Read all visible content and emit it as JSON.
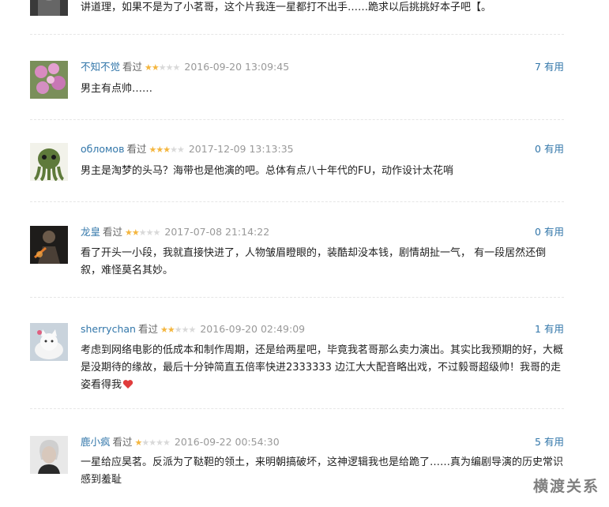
{
  "colors": {
    "link": "#3377aa",
    "star_on": "#f4b63f",
    "star_off": "#d9d9d9",
    "date": "#999999",
    "heart": "#e03c3c"
  },
  "top_partial": {
    "text": "讲道理，如果不是为了小茗哥，这个片我连一星都打不出手……跪求以后挑挑好本子吧【。",
    "avatar_icon": "avatar-dark-icon"
  },
  "reviews": [
    {
      "user": "不知不觉",
      "status": "看过",
      "rating": 2,
      "date": "2016-09-20 13:09:45",
      "votes": "7",
      "votes_suffix": "有用",
      "text": "男主有点帅……",
      "avatar_icon": "avatar-flowers-icon"
    },
    {
      "user": "обломов",
      "status": "看过",
      "rating": 3,
      "date": "2017-12-09 13:13:35",
      "votes": "0",
      "votes_suffix": "有用",
      "text": "男主是淘梦的头马？海带也是他演的吧。总体有点八十年代的FU，动作设计太花哨",
      "avatar_icon": "avatar-cthulhu-icon"
    },
    {
      "user": "龙皇",
      "status": "看过",
      "rating": 2,
      "date": "2017-07-08 21:14:22",
      "votes": "0",
      "votes_suffix": "有用",
      "text": "看了开头一小段，我就直接快进了，人物皱眉瞪眼的，装酷却没本钱，剧情胡扯一气，  有一段居然还倒叙，难怪莫名其妙。",
      "avatar_icon": "avatar-warrior-icon"
    },
    {
      "user": "sherrychan",
      "status": "看过",
      "rating": 2,
      "date": "2016-09-20 02:49:09",
      "votes": "1",
      "votes_suffix": "有用",
      "text": "考虑到网络电影的低成本和制作周期，还是给两星吧，毕竟我茗哥那么卖力演出。其实比我预期的好，大概是没期待的缘故，最后十分钟简直五倍率快进2333333 边江大大配音略出戏，不过毅哥超级帅！我哥的走姿看得我",
      "avatar_icon": "avatar-white-cat-icon"
    },
    {
      "user": "鹿小疯",
      "status": "看过",
      "rating": 1,
      "date": "2016-09-22 00:54:30",
      "votes": "5",
      "votes_suffix": "有用",
      "text": "一星给应昊茗。反派为了鞑靼的领土，来明朝搞破坏，这神逻辑我也是给跪了……真为编剧导演的历史常识感到羞耻",
      "avatar_icon": "avatar-portrait-icon"
    }
  ],
  "watermark": "横渡关系"
}
